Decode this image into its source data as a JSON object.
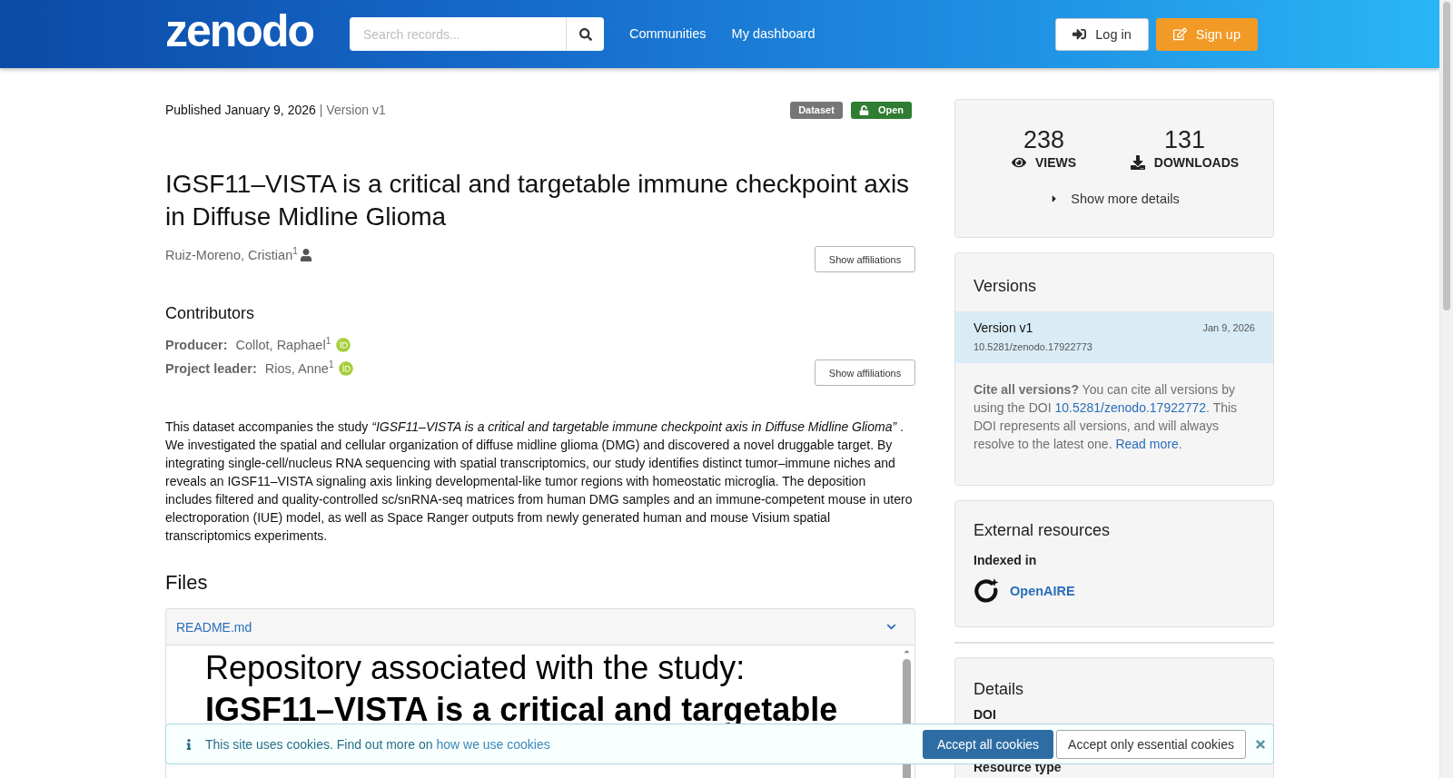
{
  "header": {
    "logo": "zenodo",
    "search": {
      "placeholder": "Search records..."
    },
    "nav": [
      {
        "label": "Communities"
      },
      {
        "label": "My dashboard"
      }
    ],
    "buttons": [
      {
        "kind": "login",
        "label": "Log in"
      },
      {
        "kind": "signup",
        "label": "Sign up"
      }
    ]
  },
  "record": {
    "published": "Published January 9, 2026",
    "version": "| Version v1",
    "badges": [
      {
        "kind": "type",
        "label": "Dataset"
      },
      {
        "kind": "access",
        "label": "Open"
      }
    ],
    "title": "IGSF11–VISTA is a critical and targetable immune checkpoint axis in Diffuse Midline Glioma",
    "creators": [
      {
        "kind": "person",
        "name": "Ruiz-Moreno, Cristian$^{1}$"
      }
    ],
    "affiliations_button": "Show affiliations",
    "contributors": {
      "heading": "Contributors",
      "items": [
        {
          "role": "Producer:",
          "name": "Collot, Raphael$^{1}$",
          "orcid": true
        },
        {
          "role": "Project leader:",
          "name": "Rios, Anne$^{1}$",
          "orcid": true
        }
      ],
      "affiliations_button": "Show affiliations"
    },
    "description": "This dataset accompanies the study *“IGSF11–VISTA is a critical and targetable immune checkpoint axis in Diffuse Midline Glioma”* . We investigated the spatial and cellular organization of diffuse midline glioma (DMG) and discovered a novel druggable target. By integrating single-cell/nucleus RNA sequencing with spatial transcriptomics, our study identifies distinct tumor–immune niches and reveals an IGSF11–VISTA signaling axis linking developmental-like tumor regions with homeostatic microglia. The deposition includes filtered and quality-controlled sc/snRNA-seq matrices from human DMG samples and an immune-competent mouse in utero electroporation (IUE) model, as well as Space Ranger outputs from newly generated human and mouse Visium spatial transcriptomics experiments."
  },
  "files": {
    "heading": "Files",
    "preview": {
      "filename": "README.md",
      "expanded": true,
      "heading": "Repository associated with the study: **IGSF11–VISTA is a critical and targetable**"
    }
  },
  "stats": {
    "items": [
      {
        "kind": "views",
        "value": "238",
        "label": "VIEWS"
      },
      {
        "kind": "downloads",
        "value": "131",
        "label": "DOWNLOADS"
      }
    ],
    "more": "Show more details"
  },
  "versions": {
    "heading": "Versions",
    "items": [
      {
        "label": "Version v1",
        "date": "Jan 9, 2026",
        "doi": "10.5281/zenodo.17922773",
        "selected": true
      }
    ],
    "cite": [
      {
        "kind": "text",
        "text": "**Cite all versions?** You can cite all versions by using the DOI "
      },
      {
        "kind": "link",
        "text": "10.5281/zenodo.17922772"
      },
      {
        "kind": "text",
        "text": ". This DOI represents all versions, and will always resolve to the latest one. "
      },
      {
        "kind": "link",
        "text": "Read more"
      },
      {
        "kind": "text",
        "text": "."
      }
    ]
  },
  "external_resources": {
    "heading": "External resources",
    "subheading": "Indexed in",
    "items": [
      {
        "name": "OpenAIRE"
      }
    ]
  },
  "details": {
    "heading": "Details",
    "fields": [
      {
        "label": "DOI"
      },
      {
        "label": "Resource type"
      }
    ]
  },
  "cookie_banner": {
    "message": [
      {
        "kind": "text",
        "text": "This site uses cookies. Find out more on "
      },
      {
        "kind": "link",
        "text": "how we use cookies"
      }
    ],
    "buttons": [
      {
        "kind": "primary",
        "label": "Accept all cookies"
      },
      {
        "kind": "secondary",
        "label": "Accept only essential cookies"
      }
    ]
  }
}
